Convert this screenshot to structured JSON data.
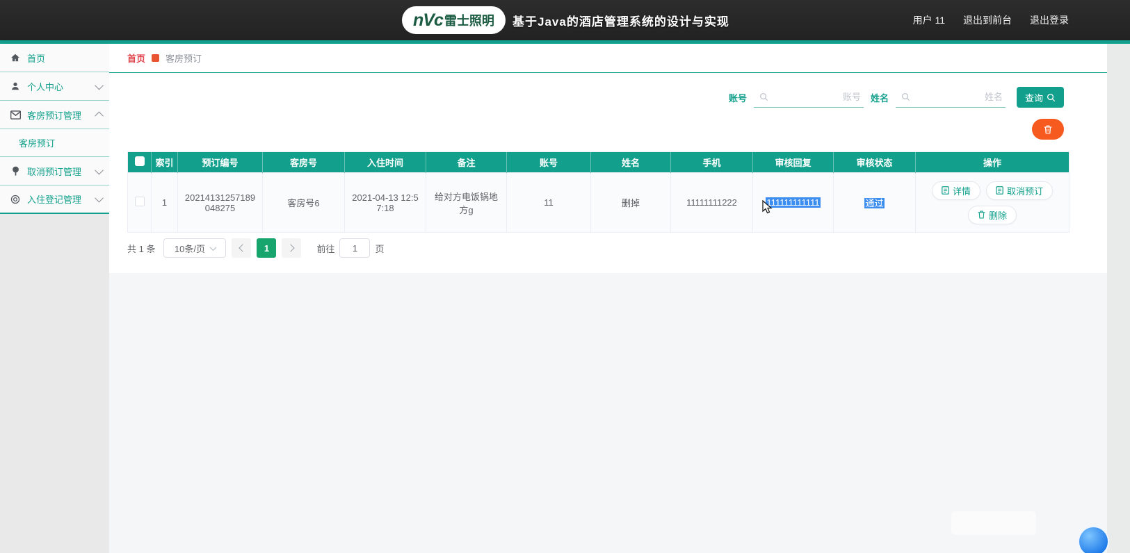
{
  "header": {
    "logo_brand": "nVc",
    "logo_cn": "雷士照明",
    "title": "基于Java的酒店管理系统的设计与实现",
    "user": "用户 11",
    "exit_to_front": "退出到前台",
    "logout": "退出登录"
  },
  "sidebar": {
    "items": [
      {
        "label": "首页",
        "icon": "home-icon"
      },
      {
        "label": "个人中心",
        "icon": "user-icon",
        "chevron": "down"
      },
      {
        "label": "客房预订管理",
        "icon": "mail-icon",
        "chevron": "up"
      },
      {
        "label": "取消预订管理",
        "icon": "pin-icon",
        "chevron": "down"
      },
      {
        "label": "入住登记管理",
        "icon": "target-icon",
        "chevron": "down"
      }
    ],
    "submenu": {
      "label": "客房预订"
    }
  },
  "breadcrumb": {
    "home": "首页",
    "current": "客房预订"
  },
  "search": {
    "account_label": "账号",
    "account_placeholder": "账号",
    "account_value": "",
    "name_label": "姓名",
    "name_placeholder": "姓名",
    "name_value": "",
    "query_label": "查询"
  },
  "table": {
    "headers": [
      "索引",
      "预订编号",
      "客房号",
      "入住时间",
      "备注",
      "账号",
      "姓名",
      "手机",
      "审核回复",
      "审核状态",
      "操作"
    ],
    "rows": [
      {
        "index": "1",
        "booking_no": "20214131257189048275",
        "room_no": "客房号6",
        "checkin_time": "2021-04-13 12:57:18",
        "remark": "给对方电饭锅地方g",
        "account": "11",
        "name": "删掉",
        "phone": "11111111222",
        "audit_reply": "111111111111",
        "audit_status": "通过",
        "actions": [
          "详情",
          "取消预订",
          "删除"
        ]
      }
    ]
  },
  "pagination": {
    "total": "共 1 条",
    "page_size": "10条/页",
    "current_page": "1",
    "goto_label": "前往",
    "goto_value": "1",
    "goto_suffix": "页"
  },
  "colors": {
    "accent_teal": "#12a08c",
    "topbar_dark": "#262626",
    "breadcrumb_red": "#e0454e",
    "breadcrumb_icon_orange": "#e8542f",
    "danger_orange": "#f75a1f",
    "selection_blue": "#3e8ef0",
    "page_active_green": "#17a56d",
    "logo_green": "#1a5b41"
  }
}
